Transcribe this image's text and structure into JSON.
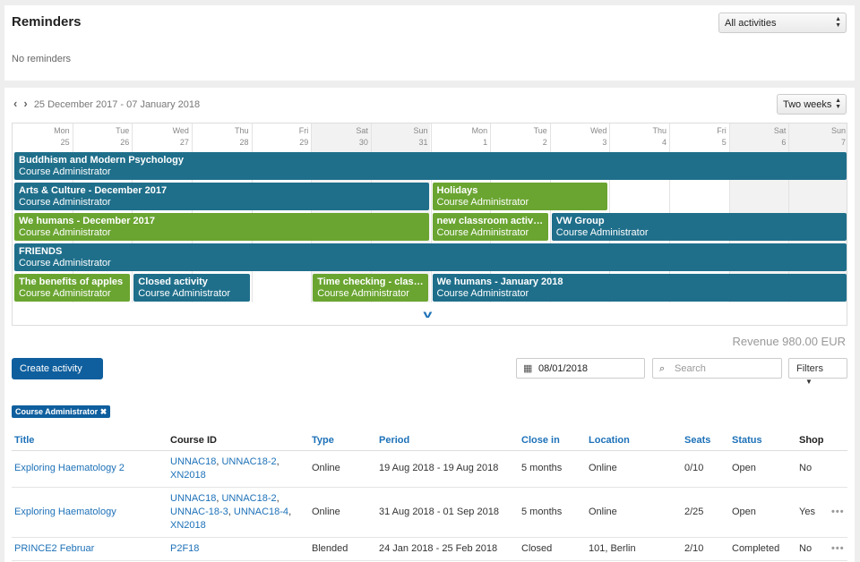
{
  "reminders": {
    "title": "Reminders",
    "empty_text": "No reminders",
    "filter_value": "All activities"
  },
  "calendar": {
    "range": "25 December 2017 - 07 January 2018",
    "period": "Two weeks",
    "days": [
      {
        "dow": "Mon",
        "num": "25"
      },
      {
        "dow": "Tue",
        "num": "26"
      },
      {
        "dow": "Wed",
        "num": "27"
      },
      {
        "dow": "Thu",
        "num": "28"
      },
      {
        "dow": "Fri",
        "num": "29"
      },
      {
        "dow": "Sat",
        "num": "30"
      },
      {
        "dow": "Sun",
        "num": "31"
      },
      {
        "dow": "Mon",
        "num": "1"
      },
      {
        "dow": "Tue",
        "num": "2"
      },
      {
        "dow": "Wed",
        "num": "3"
      },
      {
        "dow": "Thu",
        "num": "4"
      },
      {
        "dow": "Fri",
        "num": "5"
      },
      {
        "dow": "Sat",
        "num": "6"
      },
      {
        "dow": "Sun",
        "num": "7"
      }
    ],
    "events": [
      {
        "title": "Buddhism and Modern Psychology",
        "sub": "Course Administrator",
        "color": "blue",
        "row": 0,
        "start": 0,
        "span": 14
      },
      {
        "title": "Arts & Culture - December 2017",
        "sub": "Course Administrator",
        "color": "blue",
        "row": 1,
        "start": 0,
        "span": 7
      },
      {
        "title": "Holidays",
        "sub": "Course Administrator",
        "color": "green",
        "row": 1,
        "start": 7,
        "span": 3
      },
      {
        "title": "We humans - December 2017",
        "sub": "Course Administrator",
        "color": "green",
        "row": 2,
        "start": 0,
        "span": 7
      },
      {
        "title": "new classroom activity",
        "sub": "Course Administrator",
        "color": "green",
        "row": 2,
        "start": 7,
        "span": 2
      },
      {
        "title": "VW Group",
        "sub": "Course Administrator",
        "color": "blue",
        "row": 2,
        "start": 9,
        "span": 5
      },
      {
        "title": "FRIENDS",
        "sub": "Course Administrator",
        "color": "blue",
        "row": 3,
        "start": 0,
        "span": 14
      },
      {
        "title": "The benefits of apples",
        "sub": "Course Administrator",
        "color": "green",
        "row": 4,
        "start": 0,
        "span": 2
      },
      {
        "title": "Closed activity",
        "sub": "Course Administrator",
        "color": "blue",
        "row": 4,
        "start": 2,
        "span": 2
      },
      {
        "title": "Time checking - classr...",
        "sub": "Course Administrator",
        "color": "green",
        "row": 4,
        "start": 5,
        "span": 2
      },
      {
        "title": "We humans - January 2018",
        "sub": "Course Administrator",
        "color": "blue",
        "row": 4,
        "start": 7,
        "span": 7
      }
    ]
  },
  "toolbar": {
    "revenue": "Revenue 980.00 EUR",
    "create_label": "Create activity",
    "date_value": "08/01/2018",
    "search_placeholder": "Search",
    "filters_label": "Filters",
    "active_tag": "Course Administrator"
  },
  "table": {
    "headers": [
      "Title",
      "Course ID",
      "Type",
      "Period",
      "Close in",
      "Location",
      "Seats",
      "Status",
      "Shop"
    ],
    "rows": [
      {
        "title": "Exploring Haematology 2",
        "course_ids": [
          "UNNAC18",
          "UNNAC18-2",
          "XN2018"
        ],
        "type": "Online",
        "period": "19 Aug 2018 - 19 Aug 2018",
        "close_in": "5 months",
        "location": "Online",
        "seats": "0/10",
        "status": "Open",
        "shop": "No",
        "menu": ""
      },
      {
        "title": "Exploring Haematology",
        "course_ids": [
          "UNNAC18",
          "UNNAC18-2",
          "UNNAC-18-3",
          "UNNAC18-4",
          "XN2018"
        ],
        "type": "Online",
        "period": "31 Aug 2018 - 01 Sep 2018",
        "close_in": "5 months",
        "location": "Online",
        "seats": "2/25",
        "status": "Open",
        "shop": "Yes",
        "menu": "•••"
      },
      {
        "title": "PRINCE2 Februar",
        "course_ids": [
          "P2F18"
        ],
        "type": "Blended",
        "period": "24 Jan 2018 - 25 Feb 2018",
        "close_in": "Closed",
        "location": "101, Berlin",
        "seats": "2/10",
        "status": "Completed",
        "shop": "No",
        "menu": "•••"
      }
    ]
  }
}
